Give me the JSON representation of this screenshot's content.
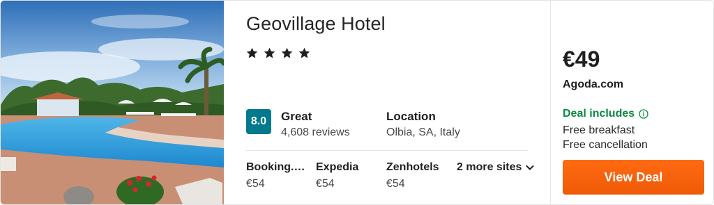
{
  "hotel": {
    "name": "Geovillage Hotel",
    "star_count": 4,
    "star_icon": "star-icon",
    "rating": {
      "score": "8.0",
      "label": "Great",
      "reviews": "4,608 reviews",
      "badge_color": "#007a8c"
    },
    "location": {
      "label": "Location",
      "value": "Olbia, SA, Italy"
    }
  },
  "providers": [
    {
      "name": "Booking.com",
      "price": "€54"
    },
    {
      "name": "Expedia",
      "price": "€54"
    },
    {
      "name": "Zenhotels",
      "price": "€54"
    }
  ],
  "more_sites": {
    "label": "2 more sites",
    "icon": "chevron-down-icon"
  },
  "offer": {
    "price": "€49",
    "site": "Agoda.com",
    "deal_heading": "Deal includes",
    "deal_heading_color": "#0a8a43",
    "info_icon": "info-icon",
    "perks": [
      "Free breakfast",
      "Free cancellation"
    ],
    "button_label": "View Deal",
    "button_color": "#f25f0a"
  }
}
